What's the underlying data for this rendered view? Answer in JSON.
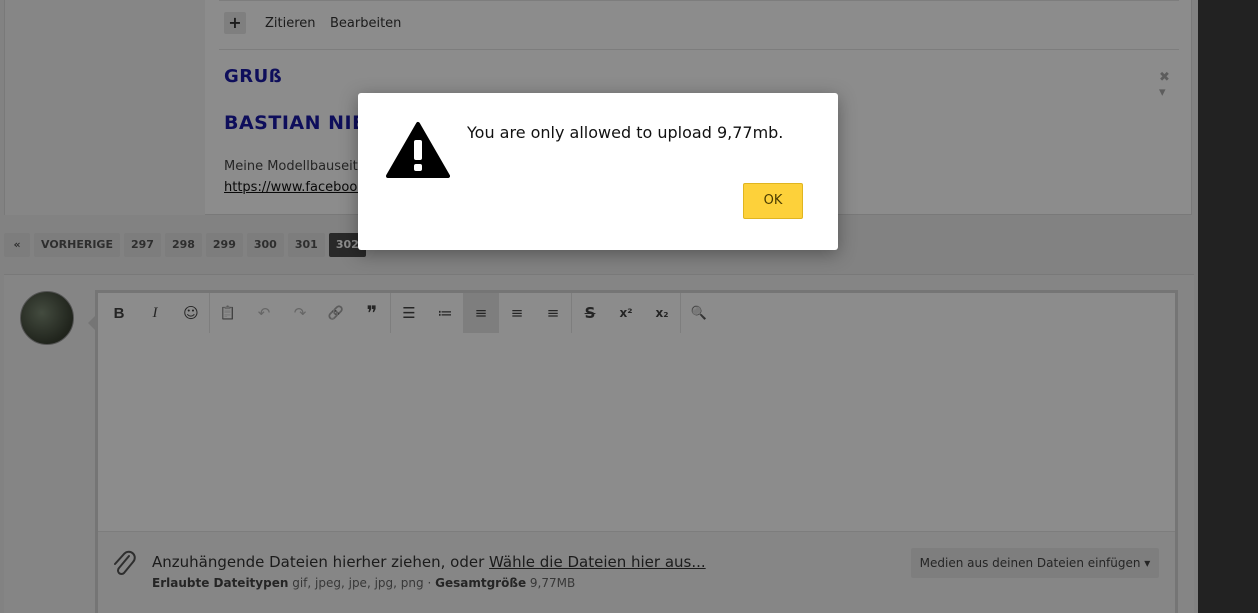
{
  "post": {
    "plus_label": "+",
    "quote_label": "Zitieren",
    "edit_label": "Bearbeiten",
    "signature_greeting": "GRUß",
    "signature_name": "BASTIAN NIE",
    "signature_text": "Meine Modellbauseite a",
    "signature_link": "https://www.facebook.c",
    "tools": "✖ ▾"
  },
  "pagination": {
    "first_icon": "«",
    "prev_label": "VORHERIGE",
    "pages": [
      "297",
      "298",
      "299",
      "300",
      "301",
      "302"
    ],
    "current": "302"
  },
  "editor": {
    "toolbar": [
      {
        "name": "bold-icon",
        "glyph": "B"
      },
      {
        "name": "italic-icon",
        "glyph": "I"
      },
      {
        "name": "smiley-icon",
        "glyph": "☺"
      },
      {
        "name": "clipboard-icon",
        "glyph": "📋"
      },
      {
        "name": "undo-icon",
        "glyph": "↶"
      },
      {
        "name": "redo-icon",
        "glyph": "↷"
      },
      {
        "name": "link-icon",
        "glyph": "🔗"
      },
      {
        "name": "quote-icon",
        "glyph": "❞"
      },
      {
        "name": "bullet-list-icon",
        "glyph": "☰"
      },
      {
        "name": "numbered-list-icon",
        "glyph": "≔"
      },
      {
        "name": "align-left-icon",
        "glyph": "≡"
      },
      {
        "name": "align-center-icon",
        "glyph": "≡"
      },
      {
        "name": "align-right-icon",
        "glyph": "≡"
      },
      {
        "name": "strikethrough-icon",
        "glyph": "S"
      },
      {
        "name": "superscript-icon",
        "glyph": "x²"
      },
      {
        "name": "subscript-icon",
        "glyph": "x₂"
      },
      {
        "name": "preview-icon",
        "glyph": "🔍"
      }
    ],
    "attach_prompt": "Anzuhängende Dateien hierher ziehen, oder ",
    "attach_link": "Wähle die Dateien hier aus...",
    "allowed_types_label": "Erlaubte Dateitypen",
    "allowed_types": "gif, jpeg, jpe, jpg, png",
    "separator": "·",
    "total_size_label": "Gesamtgröße",
    "total_size": "9,77MB",
    "media_button": "Medien aus deinen Dateien einfügen ▾"
  },
  "modal": {
    "message": "You are only allowed to upload 9,77mb.",
    "ok_label": "OK"
  },
  "colors": {
    "ok_button": "#fdd13a",
    "signature": "#1a1aa6",
    "pager_current": "#4b4b4b"
  }
}
